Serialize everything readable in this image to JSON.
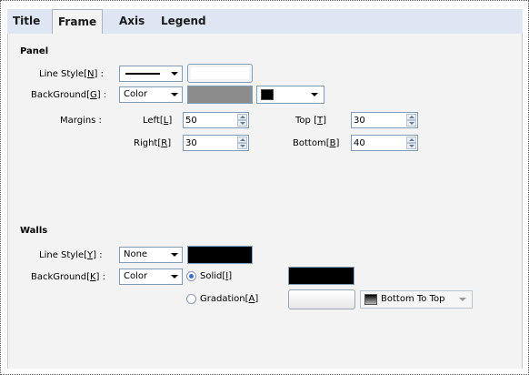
{
  "tabs": [
    {
      "label": "Title"
    },
    {
      "label": "Frame"
    },
    {
      "label": "Axis"
    },
    {
      "label": "Legend"
    }
  ],
  "panel": {
    "heading": "Panel",
    "line_style_label": "Line Style",
    "line_style_key": "N",
    "background_label": "BackGround",
    "background_key": "G",
    "background_value": "Color",
    "margins_label": "Margins :",
    "left_label": "Left",
    "left_key": "L",
    "left_value": "50",
    "top_label": "Top ",
    "top_key": "T",
    "top_value": "30",
    "right_label": "Right",
    "right_key": "R",
    "right_value": "30",
    "bottom_label": "Bottom",
    "bottom_key": "B",
    "bottom_value": "40",
    "line_color": "#ffffff",
    "bg_color": "#8c8c8c",
    "pattern_color": "#000000"
  },
  "walls": {
    "heading": "Walls",
    "line_style_label": "Line Style",
    "line_style_key": "Y",
    "line_style_value": "None",
    "background_label": "BackGround",
    "background_key": "K",
    "background_value": "Color",
    "solid_label": "Solid",
    "solid_key": "I",
    "gradation_label": "Gradation",
    "gradation_key": "A",
    "gradient_direction": "Bottom To Top",
    "line_color": "#000000",
    "solid_color": "#000000"
  },
  "colon": " :"
}
